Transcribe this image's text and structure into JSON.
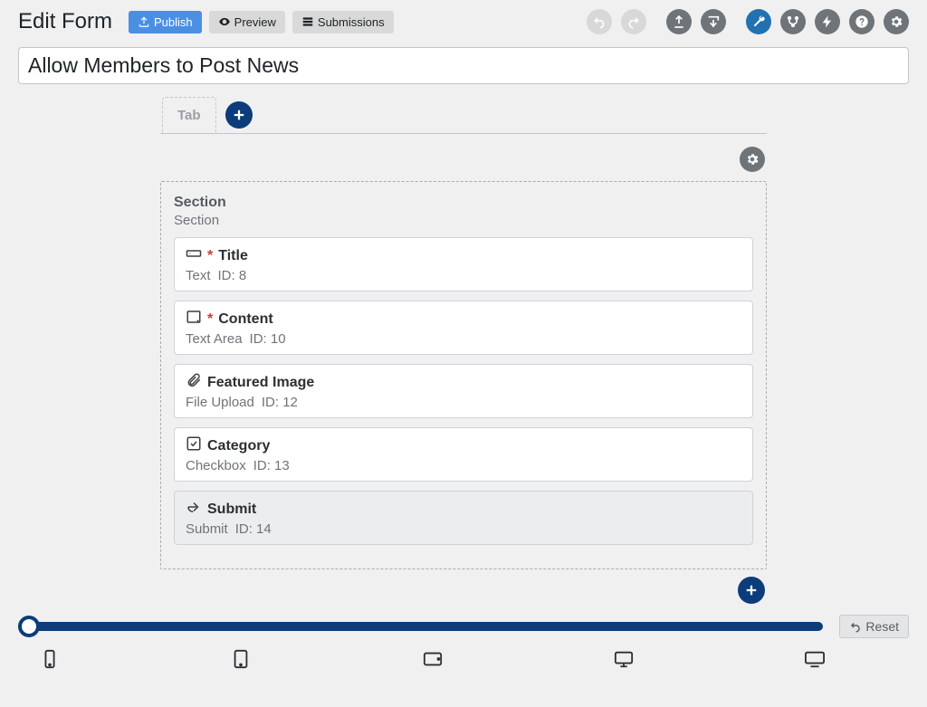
{
  "header": {
    "page_title": "Edit Form",
    "publish_label": "Publish",
    "preview_label": "Preview",
    "submissions_label": "Submissions"
  },
  "form": {
    "title_value": "Allow Members to Post News"
  },
  "tabs": {
    "ghost_label": "Tab"
  },
  "section": {
    "title": "Section",
    "subtitle": "Section"
  },
  "fields": [
    {
      "label": "Title",
      "required": true,
      "type": "Text",
      "id": "ID: 8",
      "icon": "text",
      "submit": false
    },
    {
      "label": "Content",
      "required": true,
      "type": "Text Area",
      "id": "ID: 10",
      "icon": "textarea",
      "submit": false
    },
    {
      "label": "Featured Image",
      "required": false,
      "type": "File Upload",
      "id": "ID: 12",
      "icon": "clip",
      "submit": false
    },
    {
      "label": "Category",
      "required": false,
      "type": "Checkbox",
      "id": "ID: 13",
      "icon": "check",
      "submit": false
    },
    {
      "label": "Submit",
      "required": false,
      "type": "Submit",
      "id": "ID: 14",
      "icon": "arrow",
      "submit": true
    }
  ],
  "slider": {
    "reset_label": "Reset"
  },
  "asterisk": "*"
}
